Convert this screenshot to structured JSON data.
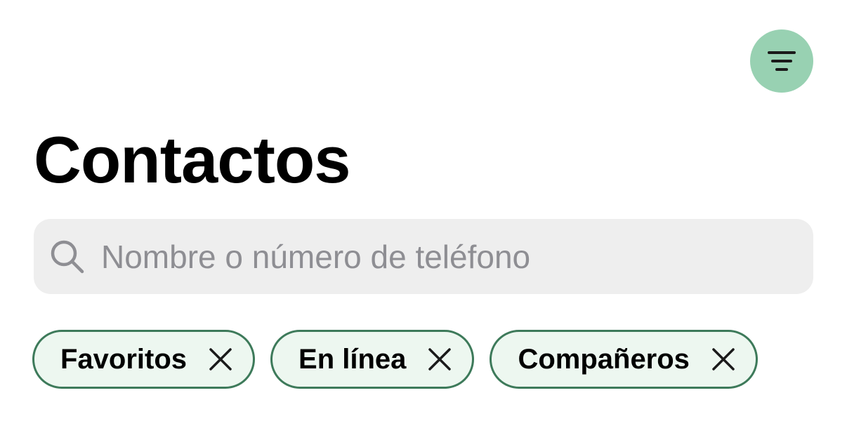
{
  "header": {
    "title": "Contactos",
    "filter_button_icon": "filter-lines-icon"
  },
  "search": {
    "placeholder": "Nombre o número de teléfono",
    "value": "",
    "icon": "search-icon"
  },
  "chips": [
    {
      "label": "Favoritos",
      "icon": "close-icon"
    },
    {
      "label": "En línea",
      "icon": "close-icon"
    },
    {
      "label": "Compañeros",
      "icon": "close-icon"
    }
  ],
  "colors": {
    "accent": "#98d1b2",
    "chip_border": "#3d7a5a",
    "chip_background": "#edf7f0",
    "search_background": "#eeeeee",
    "placeholder": "#8e8e93"
  }
}
